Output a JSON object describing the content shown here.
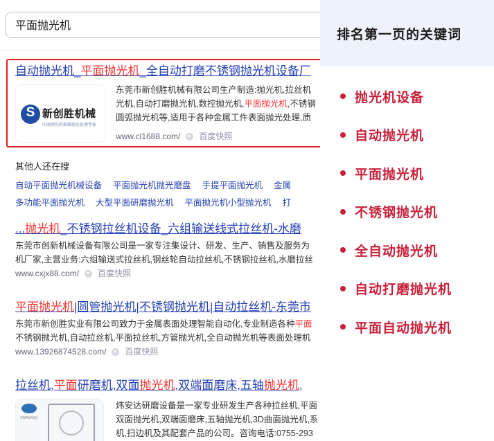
{
  "search": {
    "query": "平面抛光机"
  },
  "results": [
    {
      "title_parts": [
        {
          "t": "自动抛光机",
          "hl": false
        },
        {
          "t": "_",
          "hl": false
        },
        {
          "t": "平面抛光机",
          "hl": true
        },
        {
          "t": "_全自动打磨不锈钢抛光机设备厂",
          "hl": false
        }
      ],
      "logo_name": "新创胜机械",
      "logo_sub": "中国领先的表面抛光处理专家",
      "desc_lines": [
        [
          {
            "t": "东莞市新创胜机械有限公司生产制造:抛光机,拉丝机",
            "hl": false
          }
        ],
        [
          {
            "t": "光机,自动打磨抛光机,数控抛光机,",
            "hl": false
          },
          {
            "t": "平面抛光机",
            "hl": true
          },
          {
            "t": ",不锈钢",
            "hl": false
          }
        ],
        [
          {
            "t": "圆弧抛光机等,适用于各种金属工件表面抛光处理,质",
            "hl": false
          }
        ]
      ],
      "url": "www.cl1688.com/",
      "snapshot": "百度快照"
    },
    {
      "title_parts": [
        {
          "t": "...",
          "hl": false
        },
        {
          "t": "抛光机",
          "hl": true
        },
        {
          "t": "_不锈钢拉丝机设备_六组输送线式拉丝机-水磨",
          "hl": false
        }
      ],
      "desc_lines": [
        [
          {
            "t": "东莞市创新机械设备有限公司是一家专注集设计、研发、生产、销售及服务为",
            "hl": false
          }
        ],
        [
          {
            "t": "机厂家,主营业务:六组输送式拉丝机,钢丝轮自动拉丝机,不锈钢拉丝机,水磨拉丝",
            "hl": false
          }
        ]
      ],
      "url": "www.cxjx88.com/",
      "snapshot": "百度快照"
    },
    {
      "title_parts": [
        {
          "t": "平面抛光机",
          "hl": true
        },
        {
          "t": "|圆管抛光机|不锈钢抛光机|自动拉丝机-东莞市",
          "hl": false
        }
      ],
      "desc_lines": [
        [
          {
            "t": "东莞市新创胜实业有限公司致力于金属表面处理智能自动化,专业制造各种",
            "hl": false
          },
          {
            "t": "平面",
            "hl": true
          }
        ],
        [
          {
            "t": "不锈钢抛光机,自动拉丝机,平面拉丝机,方管抛光机,全自动抛光机等表面处理机",
            "hl": false
          }
        ]
      ],
      "url": "www.13926874528.com/",
      "snapshot": "百度快照"
    },
    {
      "title_parts": [
        {
          "t": "拉丝机,",
          "hl": false
        },
        {
          "t": "平面",
          "hl": true
        },
        {
          "t": "研磨机,双面",
          "hl": false
        },
        {
          "t": "抛光机",
          "hl": true
        },
        {
          "t": ",双端面磨床,五轴",
          "hl": false
        },
        {
          "t": "抛光机",
          "hl": true
        },
        {
          "t": ",",
          "hl": false
        }
      ],
      "img_text": "VIBANNIQI",
      "desc_lines": [
        [
          {
            "t": "炜安达研磨设备是一家专业研发生产各种拉丝机,平面",
            "hl": false
          }
        ],
        [
          {
            "t": "双面抛光机,双端面磨床,五轴抛光机,3D曲面抛光机,系",
            "hl": false
          }
        ],
        [
          {
            "t": "机,扫边机及其配套产品的公司。咨询电话:0755-293",
            "hl": false
          }
        ]
      ]
    }
  ],
  "related": {
    "heading": "其他人还在搜",
    "rows": [
      [
        "自动平面抛光机械设备",
        "平面抛光机抛光磨盘",
        "手提平面抛光机",
        "金属"
      ],
      [
        "多功能平面抛光机",
        "大型平面研磨抛光机",
        "平面抛光机小型抛光机",
        "打"
      ]
    ]
  },
  "panel": {
    "title": "排名第一页的关键词",
    "keywords": [
      "抛光机设备",
      "自动抛光机",
      "平面抛光机",
      "不锈钢抛光机",
      "全自动抛光机",
      "自动打磨抛光机",
      "平面自动抛光机"
    ],
    "accent": "#c8223b",
    "head_bg": "#eef3fb"
  },
  "colors": {
    "link": "#2440b3",
    "highlight": "#f73131",
    "box": "#e02020"
  }
}
